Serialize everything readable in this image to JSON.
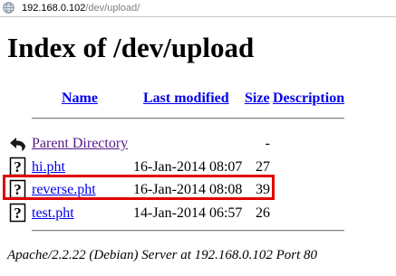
{
  "browser": {
    "url_host": "192.168.0.102",
    "url_path": "/dev/upload/"
  },
  "page": {
    "title": "Index of /dev/upload"
  },
  "table": {
    "columns": {
      "name": "Name",
      "last_modified": "Last modified",
      "size": "Size",
      "description": "Description"
    },
    "parent": {
      "label": "Parent Directory",
      "size": "-"
    },
    "rows": [
      {
        "name": "hi.pht",
        "modified": "16-Jan-2014 08:07",
        "size": "27"
      },
      {
        "name": "reverse.pht",
        "modified": "16-Jan-2014 08:08",
        "size": "39",
        "highlighted": true
      },
      {
        "name": "test.pht",
        "modified": "14-Jan-2014 06:57",
        "size": "26"
      }
    ]
  },
  "footer": {
    "server_signature": "Apache/2.2.22 (Debian) Server at 192.168.0.102 Port 80"
  },
  "colors": {
    "link": "#0000ee",
    "visited_link": "#551a8b",
    "highlight_border": "#e00000"
  },
  "icons": {
    "parent": "back-arrow-icon",
    "file": "unknown-file-icon"
  }
}
